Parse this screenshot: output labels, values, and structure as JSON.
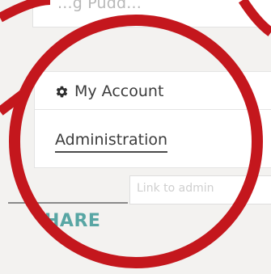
{
  "menu": {
    "partial_item_label": "...g Pudd...",
    "my_account_label": "My Account",
    "administration_label": "Administration"
  },
  "tooltip": {
    "text": "Link to admin"
  },
  "section": {
    "heading": "HARE"
  },
  "colors": {
    "annotation_red": "#c4171d",
    "section_teal": "#58a6a4",
    "menu_text": "#3c3c3c"
  },
  "icons": {
    "account": "gear-icon"
  }
}
